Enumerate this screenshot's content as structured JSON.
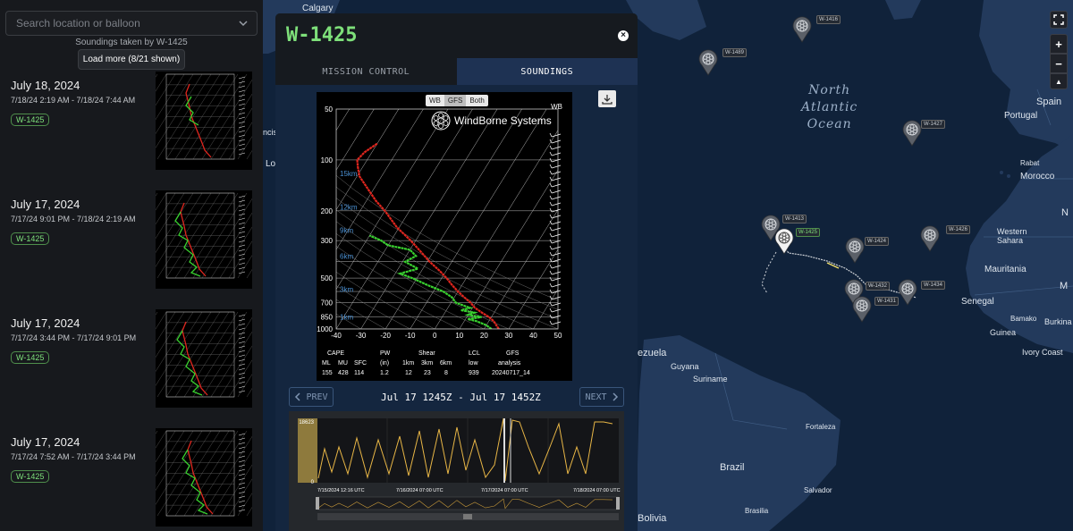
{
  "sidebar": {
    "search_placeholder": "Search location or balloon",
    "caption": "Soundings taken by W-1425",
    "load_more_label": "Load more (8/21 shown)",
    "entries": [
      {
        "date": "July 18, 2024",
        "range": "7/18/24 2:19 AM - 7/18/24 7:44 AM",
        "badge": "W-1425"
      },
      {
        "date": "July 17, 2024",
        "range": "7/17/24 9:01 PM - 7/18/24 2:19 AM",
        "badge": "W-1425"
      },
      {
        "date": "July 17, 2024",
        "range": "7/17/24 3:44 PM - 7/17/24 9:01 PM",
        "badge": "W-1425"
      },
      {
        "date": "July 17, 2024",
        "range": "7/17/24 7:52 AM - 7/17/24 3:44 PM",
        "badge": "W-1425"
      }
    ]
  },
  "modal": {
    "title": "W-1425",
    "close_symbol": "×",
    "tabs": [
      {
        "label": "MISSION CONTROL",
        "active": false
      },
      {
        "label": "SOUNDINGS",
        "active": true
      }
    ],
    "skewt": {
      "toggle": [
        "WB",
        "GFS",
        "Both"
      ],
      "selected_toggle": "GFS",
      "corner_label": "WB",
      "brand": "WindBorne Systems",
      "pressure_ticks": [
        "50",
        "100",
        "200",
        "300",
        "500",
        "700",
        "850",
        "1000"
      ],
      "temp_ticks": [
        "-40",
        "-30",
        "-20",
        "-10",
        "0",
        "10",
        "20",
        "30",
        "40",
        "50"
      ],
      "height_labels": [
        "15km",
        "12km",
        "9km",
        "6km",
        "3km",
        "1km"
      ],
      "stats": {
        "cape_header": "CAPE",
        "cape_sub": [
          "ML",
          "MU",
          "SFC"
        ],
        "cape_vals": [
          "155",
          "428",
          "114"
        ],
        "pw_header": "PW",
        "pw_sub": "(in)",
        "pw_val": "1.2",
        "shear_header": "Shear",
        "shear_sub": [
          "1km",
          "3km",
          "6km"
        ],
        "shear_vals": [
          "12",
          "23",
          "8"
        ],
        "lcl_header": "LCL",
        "lcl_sub": "low",
        "lcl_val": "939",
        "gfs_header": "GFS",
        "gfs_sub": "analysis",
        "gfs_val": "20240717_14"
      }
    },
    "nav": {
      "prev_label": "PREV",
      "next_label": "NEXT",
      "range": "Jul 17 1245Z - Jul 17 1452Z"
    },
    "timeline": {
      "y_top_label": "18623",
      "y_bottom_label": "0",
      "x_labels": [
        "7/15/2024 12:16 UTC",
        "7/16/2024 07:00 UTC",
        "7/17/2024 07:00 UTC",
        "7/18/2024 07:00 UTC"
      ]
    }
  },
  "map": {
    "ocean_label": [
      "North",
      "Atlantic",
      "Ocean"
    ],
    "places": [
      "Calgary",
      "Portugal",
      "Spain",
      "Rabat",
      "Morocco",
      "Western Sahara",
      "Mauritania",
      "Senegal",
      "Bamako",
      "Burkina",
      "Guinea",
      "Ivory Coast",
      "Guyana",
      "Suriname",
      "Fortaleza",
      "Brazil",
      "Salvador",
      "Brasilia",
      "Bolivia",
      "ezuela",
      "ncis",
      "Lo",
      "M",
      "N"
    ],
    "balloons": [
      "W-1416",
      "W-1489",
      "W-1427",
      "W-1413",
      "W-1425",
      "W-1424",
      "W-1426",
      "W-1432",
      "W-1431",
      "W-1434"
    ],
    "zoom_in": "+",
    "zoom_out": "−",
    "reset_symbol": "▲"
  }
}
